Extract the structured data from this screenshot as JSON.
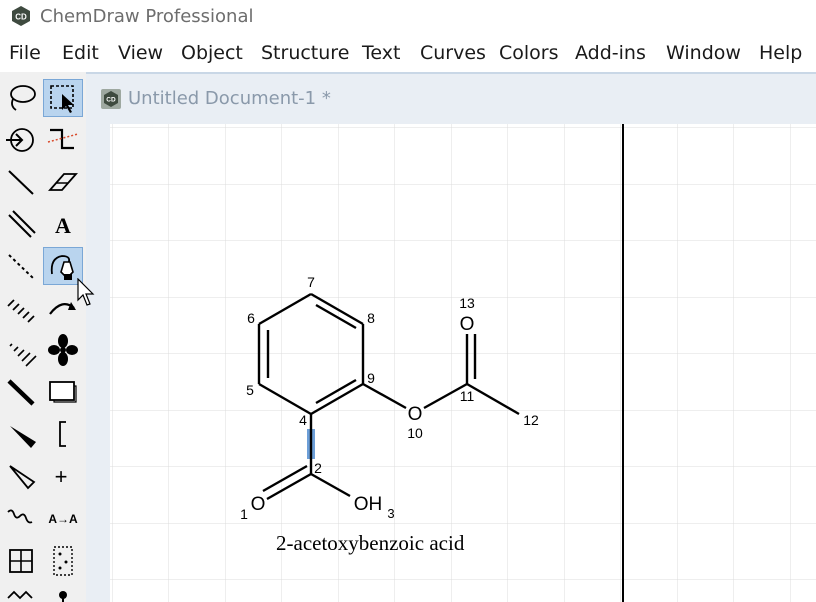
{
  "window": {
    "title": "ChemDraw Professional",
    "icon": "chemdraw-cd-icon"
  },
  "menubar": {
    "items": [
      "File",
      "Edit",
      "View",
      "Object",
      "Structure",
      "Text",
      "Curves",
      "Colors",
      "Add-ins",
      "Window",
      "Help"
    ]
  },
  "toolbar": {
    "tools": [
      {
        "name": "lasso-tool",
        "icon": "lasso-icon"
      },
      {
        "name": "marquee-tool",
        "icon": "marquee-select-icon",
        "selected": true
      },
      {
        "name": "structure-perspective-tool",
        "icon": "rotate-3d-icon"
      },
      {
        "name": "mass-fragmentation-tool",
        "icon": "fragmentation-icon"
      },
      {
        "name": "solid-bond-tool",
        "icon": "solid-bond-icon"
      },
      {
        "name": "eraser-tool",
        "icon": "eraser-icon"
      },
      {
        "name": "multiple-bonds-tool",
        "icon": "double-bond-icon"
      },
      {
        "name": "text-tool",
        "icon": "text-a-icon",
        "label": "A"
      },
      {
        "name": "dashed-bond-tool",
        "icon": "dashed-bond-icon"
      },
      {
        "name": "pen-tool",
        "icon": "pen-icon",
        "selected": true
      },
      {
        "name": "hashed-bond-tool",
        "icon": "hashed-bond-icon"
      },
      {
        "name": "arrow-tool",
        "icon": "curved-arrow-icon"
      },
      {
        "name": "hashed-wedge-tool",
        "icon": "hashed-wedge-icon"
      },
      {
        "name": "orbital-tool",
        "icon": "orbital-icon"
      },
      {
        "name": "bold-bond-tool",
        "icon": "bold-bond-icon"
      },
      {
        "name": "drawing-elements-tool",
        "icon": "rectangle-icon"
      },
      {
        "name": "wedge-bond-tool",
        "icon": "wedge-bond-icon"
      },
      {
        "name": "brackets-tool",
        "icon": "bracket-icon"
      },
      {
        "name": "hollow-wedge-tool",
        "icon": "hollow-wedge-icon"
      },
      {
        "name": "chemical-symbols-tool",
        "icon": "plus-icon",
        "label": "+"
      },
      {
        "name": "wavy-bond-tool",
        "icon": "wavy-bond-icon"
      },
      {
        "name": "reaction-atom-mapping-tool",
        "icon": "atom-map-icon",
        "label": "A→A"
      },
      {
        "name": "table-tool",
        "icon": "table-icon"
      },
      {
        "name": "tlc-plate-tool",
        "icon": "tlc-plate-icon"
      }
    ]
  },
  "document": {
    "title": "Untitled Document-1 *",
    "icon": "chemdraw-doc-icon"
  },
  "molecule": {
    "name": "2-acetoxybenzoic acid",
    "atom_numbers": [
      "1",
      "2",
      "3",
      "4",
      "5",
      "6",
      "7",
      "8",
      "9",
      "10",
      "11",
      "12",
      "13"
    ],
    "atom_labels": {
      "carbonyl_o": "O",
      "hydroxyl": "OH",
      "hydroxyl_sub": "3",
      "ester_o": "O",
      "acetyl_o": "O"
    },
    "highlight_color": "#6d9fd8"
  }
}
